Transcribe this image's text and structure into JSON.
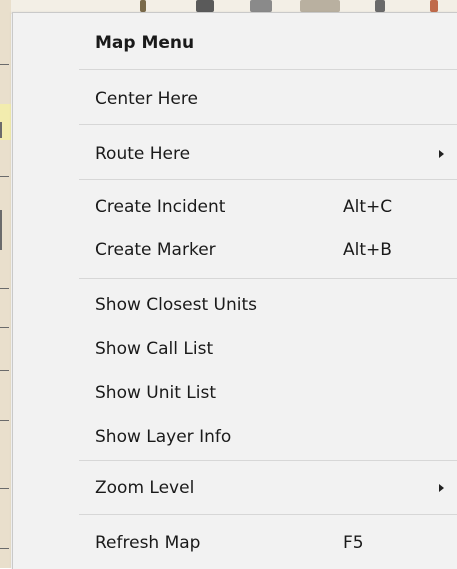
{
  "menu": {
    "header": "Map Menu",
    "items": [
      {
        "label": "Center Here",
        "shortcut": ""
      },
      {
        "label": "Route Here",
        "shortcut": "",
        "submenu": true
      },
      {
        "label": "Create Incident",
        "shortcut": "Alt+C"
      },
      {
        "label": "Create Marker",
        "shortcut": "Alt+B"
      },
      {
        "label": "Show Closest Units",
        "shortcut": ""
      },
      {
        "label": "Show Call List",
        "shortcut": ""
      },
      {
        "label": "Show Unit List",
        "shortcut": ""
      },
      {
        "label": "Show Layer Info",
        "shortcut": ""
      },
      {
        "label": "Zoom Level",
        "shortcut": "",
        "submenu": true
      },
      {
        "label": "Refresh Map",
        "shortcut": "F5"
      }
    ]
  },
  "colors": {
    "menu_background": "#f2f2f2",
    "separator": "#d7d7d7",
    "text": "#1a1a1a"
  }
}
